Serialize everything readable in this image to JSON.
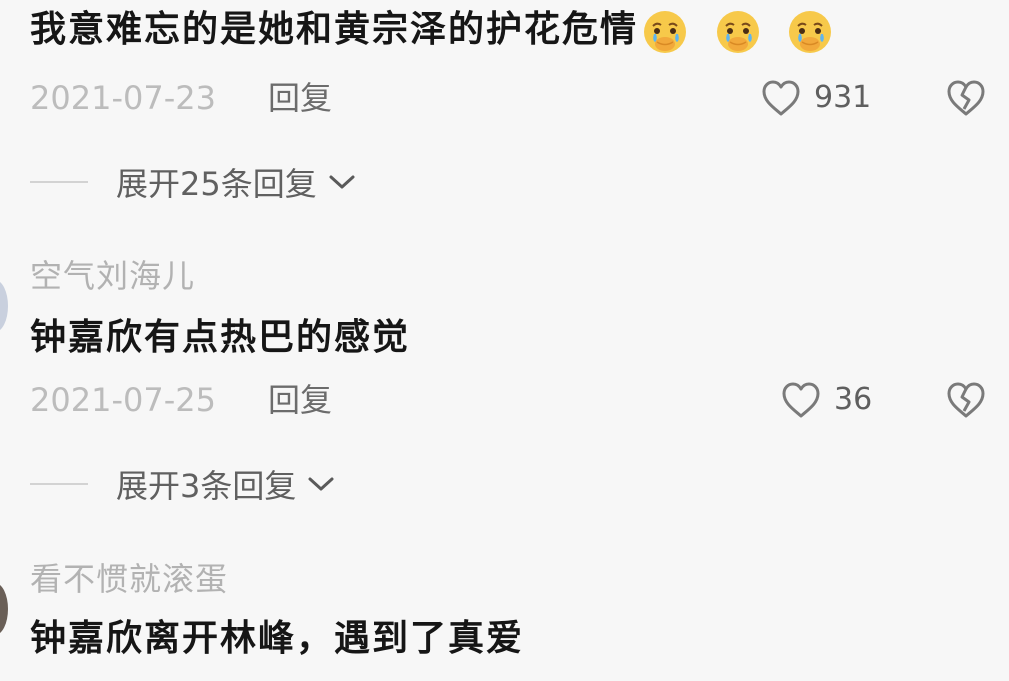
{
  "comments": [
    {
      "username": "",
      "text": "我意难忘的是她和黄宗泽的护花危情",
      "emoji_icons": [
        "crying-hands-emoji",
        "crying-hands-emoji",
        "crying-hands-emoji"
      ],
      "date": "2021-07-23",
      "reply_label": "回复",
      "like_count": "931",
      "expand_label": "展开25条回复"
    },
    {
      "username": "空气刘海儿",
      "text": "钟嘉欣有点热巴的感觉",
      "date": "2021-07-25",
      "reply_label": "回复",
      "like_count": "36",
      "expand_label": "展开3条回复"
    },
    {
      "username": "看不惯就滚蛋",
      "text": "钟嘉欣离开林峰，遇到了真爱"
    }
  ],
  "icons": {
    "like": "heart-outline-icon",
    "dislike": "broken-heart-icon",
    "expand": "chevron-down-icon"
  },
  "colors": {
    "background": "#f7f7f7",
    "text": "#161616",
    "muted": "#b2b2b2",
    "secondary": "#606060",
    "emoji_face": "#f7c94a"
  }
}
